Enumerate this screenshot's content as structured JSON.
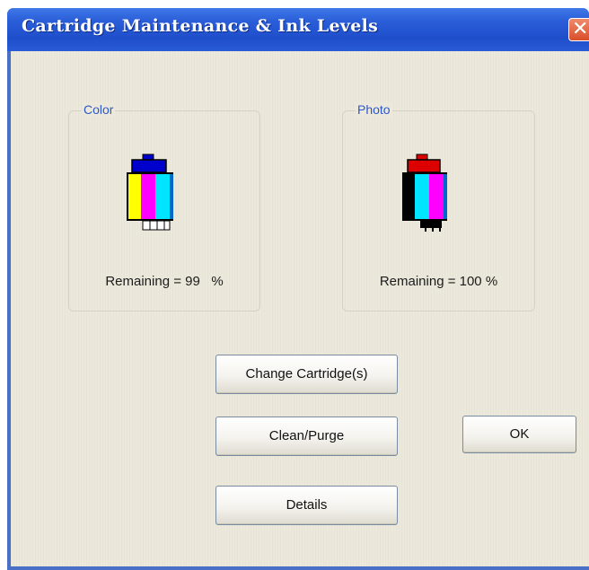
{
  "window": {
    "title": "Cartridge Maintenance & Ink Levels",
    "close_glyph": "✕"
  },
  "cartridges": [
    {
      "label": "Color",
      "remaining_text": "Remaining = 99   %",
      "remaining_percent": 99,
      "inks": [
        "#ffff00",
        "#ff00ff",
        "#00e5ff"
      ],
      "cap_color": "#0000cc"
    },
    {
      "label": "Photo",
      "remaining_text": "Remaining = 100 %",
      "remaining_percent": 100,
      "inks": [
        "#000000",
        "#00e5ff",
        "#ff00ff"
      ],
      "cap_color": "#dd0000"
    }
  ],
  "buttons": {
    "change_cartridges": "Change Cartridge(s)",
    "clean_purge": "Clean/Purge",
    "details": "Details",
    "ok": "OK"
  },
  "colors": {
    "title_bar": "#2458d6",
    "group_label": "#2e58c8",
    "client_bg": "#ece9dc"
  }
}
